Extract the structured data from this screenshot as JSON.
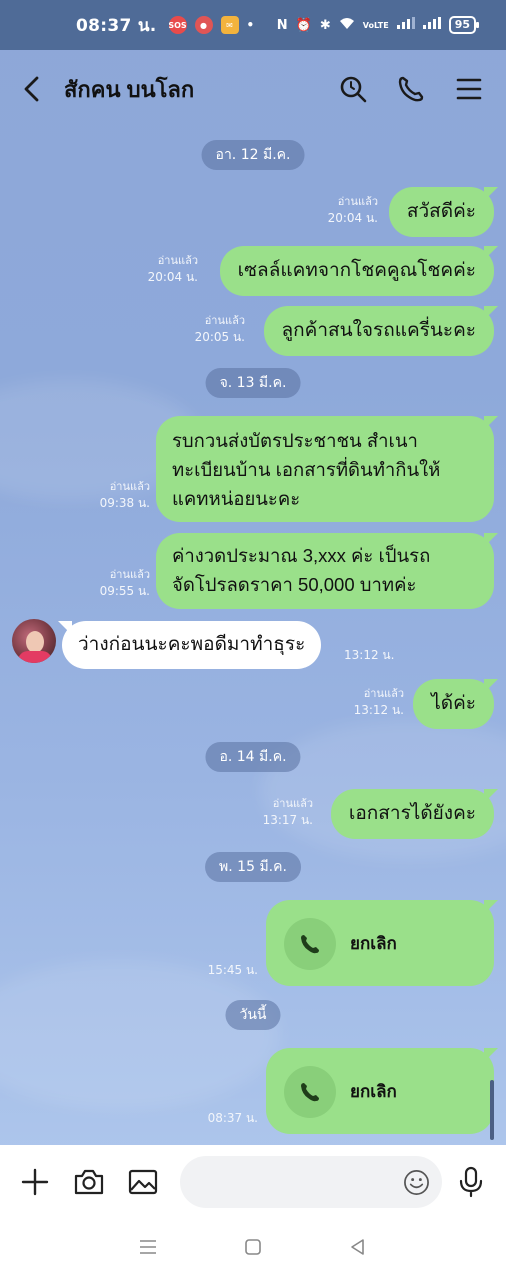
{
  "status_bar": {
    "time": "08:37 น.",
    "battery": "95",
    "network_label": "VoLTE"
  },
  "header": {
    "title": "สักคน บนโลก"
  },
  "messages": {
    "date1": "อา. 12 มี.ค.",
    "m1": {
      "text": "สวัสดีค่ะ",
      "status": "อ่านแล้ว",
      "time": "20:04 น."
    },
    "m2": {
      "text": "เซลล์แคทจากโชคคูณโชคค่ะ",
      "status": "อ่านแล้ว",
      "time": "20:04 น."
    },
    "m3": {
      "text": "ลูกค้าสนใจรถแครี่นะคะ",
      "status": "อ่านแล้ว",
      "time": "20:05 น."
    },
    "date2": "จ. 13 มี.ค.",
    "m4": {
      "line1": "รบกวนส่งบัตรประชาชน สำเนา",
      "line2": "ทะเบียนบ้าน เอกสารที่ดินทำกินให้",
      "line3": "แคทหน่อยนะคะ",
      "status": "อ่านแล้ว",
      "time": "09:38 น."
    },
    "m5": {
      "line1": "ค่างวดประมาณ 3,xxx ค่ะ เป็นรถ",
      "line2": "จัดโปรลดราคา 50,000 บาทค่ะ",
      "status": "อ่านแล้ว",
      "time": "09:55 น."
    },
    "m6": {
      "text": "ว่างก่อนนะคะพอดีมาทำธุระ",
      "time": "13:12 น."
    },
    "m7": {
      "text": "ได้ค่ะ",
      "status": "อ่านแล้ว",
      "time": "13:12 น."
    },
    "date3": "อ. 14 มี.ค.",
    "m8": {
      "text": "เอกสารได้ยังคะ",
      "status": "อ่านแล้ว",
      "time": "13:17 น."
    },
    "date4": "พ. 15 มี.ค.",
    "call1": {
      "label": "ยกเลิก",
      "time": "15:45 น."
    },
    "date5": "วันนี้",
    "call2": {
      "label": "ยกเลิก",
      "time": "08:37 น."
    }
  },
  "input": {
    "placeholder": "",
    "value": ""
  },
  "colors": {
    "bubble_out": "#9ae08a",
    "bubble_in": "#ffffff",
    "background": "#8ea7d8",
    "status_bar": "#4f6b97"
  }
}
